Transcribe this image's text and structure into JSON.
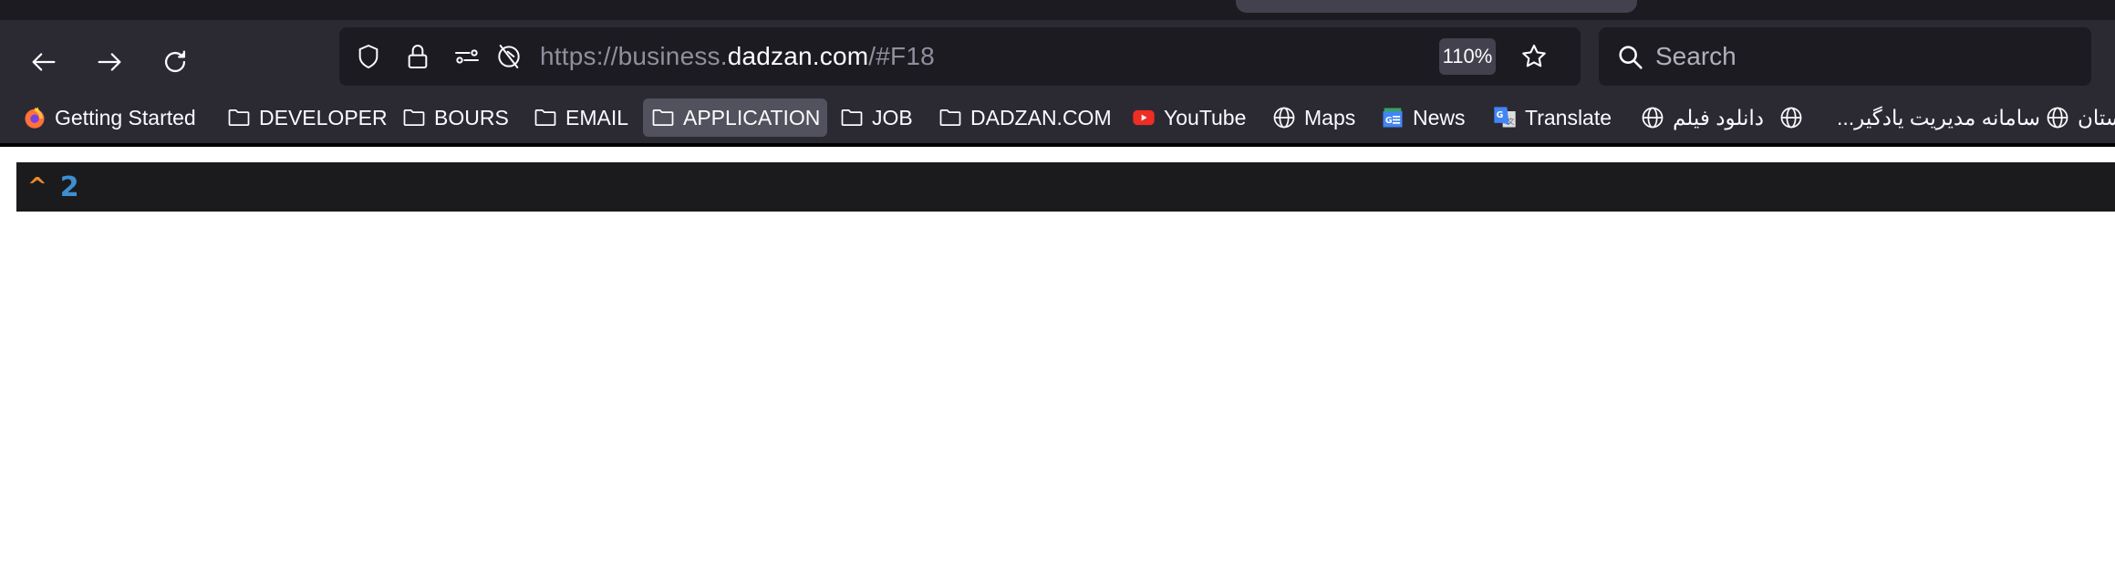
{
  "browser": {
    "tab_strip": {
      "active_tab_title": ""
    },
    "toolbar": {
      "back_label": "Back",
      "forward_label": "Forward",
      "reload_label": "Reload",
      "url": {
        "scheme": "https://business.",
        "host": "dadzan.com",
        "path": "/#F18"
      },
      "zoom_level": "110%",
      "search_placeholder": "Search"
    },
    "bookmarks": [
      {
        "label": "Getting Started",
        "icon": "firefox-icon"
      },
      {
        "label": "DEVELOPER",
        "icon": "folder-icon"
      },
      {
        "label": "BOURS",
        "icon": "folder-icon"
      },
      {
        "label": "EMAIL",
        "icon": "folder-icon"
      },
      {
        "label": "APPLICATION",
        "icon": "folder-icon",
        "active": true
      },
      {
        "label": "JOB",
        "icon": "folder-icon"
      },
      {
        "label": "DADZAN.COM",
        "icon": "folder-icon"
      },
      {
        "label": "YouTube",
        "icon": "youtube-icon"
      },
      {
        "label": "Maps",
        "icon": "globe-icon"
      },
      {
        "label": "News",
        "icon": "google-news-icon"
      },
      {
        "label": "Translate",
        "icon": "google-translate-icon"
      },
      {
        "label": "دانلود فیلم",
        "icon": "globe-icon"
      },
      {
        "label": "سامانه مدیریت یادگیر...",
        "icon": "globe-icon"
      },
      {
        "label": "ستان",
        "icon": "globe-icon"
      }
    ]
  },
  "page": {
    "toggle_symbol": "^",
    "count": "2"
  },
  "colors": {
    "toolbar_bg": "#2b2a33",
    "field_bg": "#1c1b22",
    "caret": "#e8892c",
    "count": "#3d8fd1"
  }
}
